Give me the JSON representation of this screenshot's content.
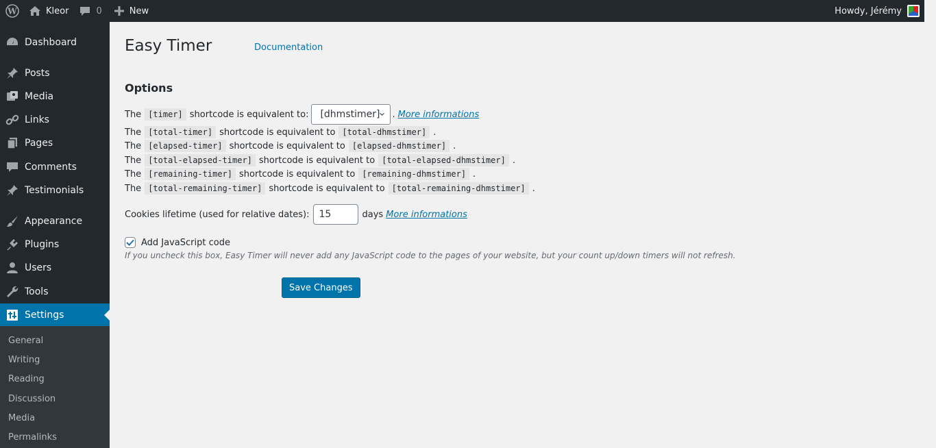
{
  "admin_bar": {
    "site_name": "Kleor",
    "comments_count": "0",
    "new_label": "New",
    "howdy": "Howdy, Jérémy"
  },
  "sidebar": {
    "items": [
      {
        "label": "Dashboard",
        "icon": "dashboard-icon"
      },
      {
        "label": "Posts",
        "icon": "pin-icon"
      },
      {
        "label": "Media",
        "icon": "media-icon"
      },
      {
        "label": "Links",
        "icon": "link-icon"
      },
      {
        "label": "Pages",
        "icon": "pages-icon"
      },
      {
        "label": "Comments",
        "icon": "comment-icon"
      },
      {
        "label": "Testimonials",
        "icon": "pin-icon"
      },
      {
        "label": "Appearance",
        "icon": "brush-icon"
      },
      {
        "label": "Plugins",
        "icon": "plugin-icon"
      },
      {
        "label": "Users",
        "icon": "user-icon"
      },
      {
        "label": "Tools",
        "icon": "wrench-icon"
      },
      {
        "label": "Settings",
        "icon": "settings-icon"
      }
    ],
    "current": "Settings",
    "submenu": [
      "General",
      "Writing",
      "Reading",
      "Discussion",
      "Media",
      "Permalinks"
    ]
  },
  "page": {
    "title": "Easy Timer",
    "documentation_link": "Documentation",
    "section_title": "Options",
    "timer_row": {
      "prefix": "The",
      "code": "[timer]",
      "text": "shortcode is equivalent to:",
      "select_value": "[dhmstimer]",
      "separator": ".",
      "more_link": "More informations"
    },
    "equivalences": [
      {
        "prefix": "The",
        "code": "[total-timer]",
        "text": "shortcode is equivalent to",
        "target": "[total-dhmstimer]",
        "end": "."
      },
      {
        "prefix": "The",
        "code": "[elapsed-timer]",
        "text": "shortcode is equivalent to",
        "target": "[elapsed-dhmstimer]",
        "end": "."
      },
      {
        "prefix": "The",
        "code": "[total-elapsed-timer]",
        "text": "shortcode is equivalent to",
        "target": "[total-elapsed-dhmstimer]",
        "end": "."
      },
      {
        "prefix": "The",
        "code": "[remaining-timer]",
        "text": "shortcode is equivalent to",
        "target": "[remaining-dhmstimer]",
        "end": "."
      },
      {
        "prefix": "The",
        "code": "[total-remaining-timer]",
        "text": "shortcode is equivalent to",
        "target": "[total-remaining-dhmstimer]",
        "end": "."
      }
    ],
    "cookies": {
      "label": "Cookies lifetime (used for relative dates):",
      "value": "15",
      "unit": "days",
      "more_link": "More informations"
    },
    "javascript": {
      "label": "Add JavaScript code",
      "checked": true,
      "description": "If you uncheck this box, Easy Timer will never add any JavaScript code to the pages of your website, but your count up/down timers will not refresh."
    },
    "save_label": "Save Changes"
  },
  "colors": {
    "accent": "#0073aa",
    "sidebar_bg": "#23282d",
    "submenu_bg": "#32373c",
    "content_bg": "#f1f1f1"
  }
}
